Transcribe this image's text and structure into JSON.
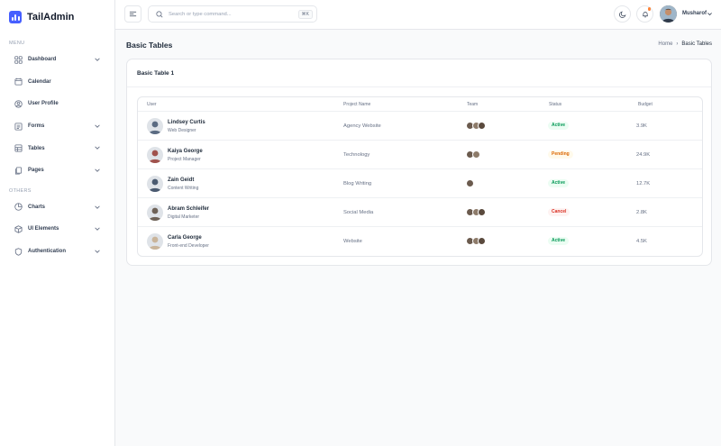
{
  "brand": {
    "name": "TailAdmin",
    "color": "#465fff"
  },
  "sidebar": {
    "menu_label": "MENU",
    "others_label": "OTHERS",
    "menu_items": [
      {
        "label": "Dashboard",
        "icon": "grid-icon",
        "has_chevron": true
      },
      {
        "label": "Calendar",
        "icon": "calendar-icon",
        "has_chevron": false
      },
      {
        "label": "User Profile",
        "icon": "user-circle-icon",
        "has_chevron": false
      },
      {
        "label": "Forms",
        "icon": "list-icon",
        "has_chevron": true
      },
      {
        "label": "Tables",
        "icon": "table-icon",
        "has_chevron": true
      },
      {
        "label": "Pages",
        "icon": "pages-icon",
        "has_chevron": true
      }
    ],
    "other_items": [
      {
        "label": "Charts",
        "icon": "pie-chart-icon",
        "has_chevron": true
      },
      {
        "label": "UI Elements",
        "icon": "box-icon",
        "has_chevron": true
      },
      {
        "label": "Authentication",
        "icon": "shield-icon",
        "has_chevron": true
      }
    ]
  },
  "header": {
    "search_placeholder": "Search or type command...",
    "search_shortcut": "⌘K",
    "user_name": "Musharof"
  },
  "page": {
    "title": "Basic Tables",
    "breadcrumb_home": "Home",
    "breadcrumb_separator": "›",
    "breadcrumb_current": "Basic Tables"
  },
  "card": {
    "title": "Basic Table 1",
    "columns": [
      "User",
      "Project Name",
      "Team",
      "Status",
      "Budget"
    ],
    "rows": [
      {
        "name": "Lindsey Curtis",
        "role": "Web Designer",
        "project": "Agency Website",
        "team_count": 3,
        "status": "Active",
        "status_kind": "active",
        "budget": "3.9K",
        "avatar_color": "#5b6b82"
      },
      {
        "name": "Kaiya George",
        "role": "Project Manager",
        "project": "Technology",
        "team_count": 2,
        "status": "Pending",
        "status_kind": "pending",
        "budget": "24.9K",
        "avatar_color": "#a0524d"
      },
      {
        "name": "Zain Geidt",
        "role": "Content Writing",
        "project": "Blog Writing",
        "team_count": 1,
        "status": "Active",
        "status_kind": "active",
        "budget": "12.7K",
        "avatar_color": "#4a5a70"
      },
      {
        "name": "Abram Schleifer",
        "role": "Digital Marketer",
        "project": "Social Media",
        "team_count": 3,
        "status": "Cancel",
        "status_kind": "cancel",
        "budget": "2.8K",
        "avatar_color": "#6e6257"
      },
      {
        "name": "Carla George",
        "role": "Front-end Developer",
        "project": "Website",
        "team_count": 3,
        "status": "Active",
        "status_kind": "active",
        "budget": "4.5K",
        "avatar_color": "#c9b49a"
      }
    ]
  },
  "team_colors": [
    "#6b5b4e",
    "#8d7b6a",
    "#5a4a3d"
  ]
}
